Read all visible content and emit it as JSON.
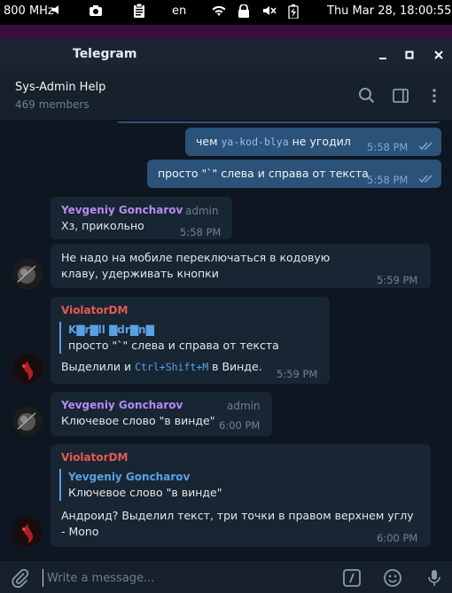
{
  "system_bar": {
    "cpu": "800 MHz",
    "keyboard_layout": "en",
    "datetime": "Thu Mar 28, 18:00:55"
  },
  "window": {
    "title": "Telegram"
  },
  "chat": {
    "name": "Sys-Admin Help",
    "members": "469 members"
  },
  "messages": [
    {
      "type": "outgoing",
      "parts": [
        "чем ",
        "ya-kod-blya",
        " не угодил"
      ],
      "time": "5:58 PM"
    },
    {
      "type": "outgoing",
      "text": "просто \"`\" слева и справа от текста",
      "time": "5:58 PM"
    },
    {
      "type": "incoming",
      "sender": "Yevgeniy Goncharov",
      "role": "admin",
      "text": "Хз, прикольно",
      "time": "5:58 PM"
    },
    {
      "type": "incoming",
      "text": "Не надо на мобиле переключаться в кодовую клаву, удерживать кнопки",
      "time": "5:59 PM"
    },
    {
      "type": "incoming",
      "sender": "ViolatorDM",
      "reply_name": "K▇r▇ll ▇dr▇n▇",
      "reply_text": "просто \"`\" слева и справа от текста",
      "parts": [
        "Выделили и ",
        "Ctrl+Shift+M",
        " в Винде."
      ],
      "time": "5:59 PM"
    },
    {
      "type": "incoming",
      "sender": "Yevgeniy Goncharov",
      "role": "admin",
      "text": "Ключевое слово \"в винде\"",
      "time": "6:00 PM"
    },
    {
      "type": "incoming",
      "sender": "ViolatorDM",
      "reply_name": "Yevgeniy Goncharov",
      "reply_text": "Ключевое слово \"в винде\"",
      "text": "Андроид? Выделил текст, три точки в правом верхнем углу - Mono",
      "time": "6:00 PM"
    }
  ],
  "composer": {
    "placeholder": "Write a message..."
  },
  "colors": {
    "background": "#0e1621",
    "outgoing_bubble": "#2b5278",
    "incoming_bubble": "#182533",
    "accent": "#5aa1e3",
    "sender_yevgeniy": "#b38cf0",
    "sender_violator": "#e8584f"
  },
  "icons": [
    "wifi-icon",
    "lock-icon",
    "battery-icon",
    "search-icon",
    "sidebar-icon",
    "more-icon",
    "attach-icon",
    "commands-icon",
    "emoji-icon",
    "microphone-icon"
  ]
}
